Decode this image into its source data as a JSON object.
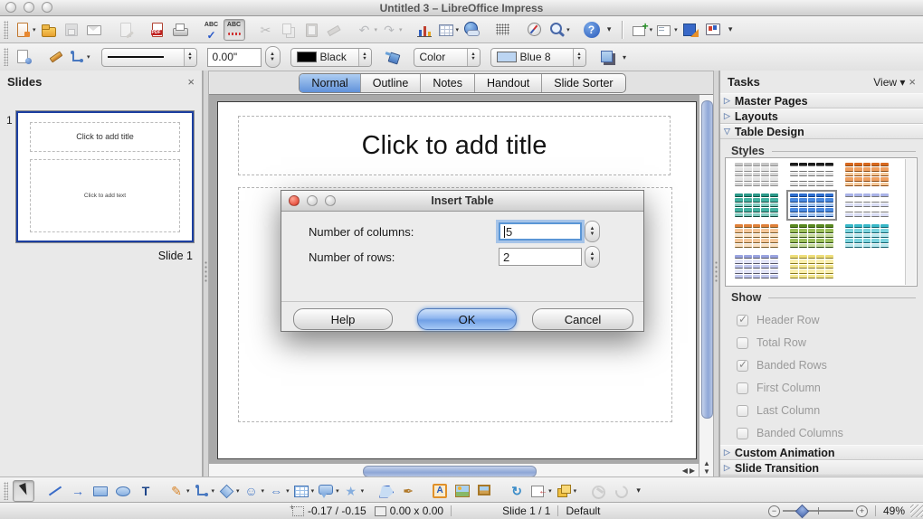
{
  "window": {
    "title": "Untitled 3 – LibreOffice Impress"
  },
  "toolbar_main": {
    "items": [
      {
        "name": "new-presentation",
        "kind": "doc",
        "dd": true
      },
      {
        "name": "open",
        "kind": "folder"
      },
      {
        "name": "save",
        "kind": "floppy",
        "disabled": true
      },
      {
        "name": "email",
        "kind": "mail"
      },
      {
        "gap": true
      },
      {
        "name": "edit-file",
        "kind": "editdoc",
        "disabled": true
      },
      {
        "gap": true
      },
      {
        "name": "export-pdf",
        "kind": "pdf"
      },
      {
        "name": "print",
        "kind": "print"
      },
      {
        "gap": true
      },
      {
        "name": "spelling",
        "kind": "abc-check"
      },
      {
        "name": "auto-spellcheck",
        "kind": "abc-wave",
        "active": true
      },
      {
        "gap": true
      },
      {
        "name": "cut",
        "kind": "char",
        "char": "✂",
        "color": "#666",
        "disabled": true
      },
      {
        "name": "copy",
        "kind": "copy",
        "disabled": true
      },
      {
        "name": "paste",
        "kind": "paste",
        "disabled": true
      },
      {
        "name": "clone-formatting",
        "kind": "brush",
        "disabled": true
      },
      {
        "gap": true
      },
      {
        "name": "undo",
        "kind": "char",
        "char": "↶",
        "color": "#3a62b8",
        "disabled": true,
        "dd": true
      },
      {
        "name": "redo",
        "kind": "char",
        "char": "↷",
        "color": "#3a62b8",
        "disabled": true,
        "dd": true
      },
      {
        "gap": true
      },
      {
        "name": "insert-chart",
        "kind": "chart"
      },
      {
        "name": "insert-table",
        "kind": "table",
        "dd": true
      },
      {
        "name": "hyperlink",
        "kind": "globe"
      },
      {
        "gap": true
      },
      {
        "name": "display-grid",
        "kind": "dots"
      },
      {
        "gap": true
      },
      {
        "name": "navigator",
        "kind": "compass"
      },
      {
        "name": "zoom",
        "kind": "zoomglass",
        "dd": true
      },
      {
        "gap": true
      },
      {
        "name": "help",
        "kind": "help"
      },
      {
        "name": "toolbar-overflow",
        "kind": "char",
        "char": "▾",
        "color": "#333",
        "small": true
      },
      {
        "sep": true
      },
      {
        "name": "new-slide",
        "kind": "slideplus",
        "dd": true
      },
      {
        "name": "slide-layout",
        "kind": "layout",
        "dd": true
      },
      {
        "name": "design",
        "kind": "design"
      },
      {
        "name": "start-presentation",
        "kind": "screen"
      },
      {
        "name": "presentation-overflow",
        "kind": "char",
        "char": "▾",
        "color": "#333",
        "small": true
      }
    ]
  },
  "toolbar_line": {
    "width_value": "0.00\"",
    "line_color_label": "Black",
    "line_color_hex": "#000000",
    "fill_type_label": "Color",
    "fill_color_label": "Blue 8",
    "fill_color_hex": "#bcd5f2",
    "icons": [
      "styles-preview-icon",
      "pen-icon",
      "arrow-style-icon",
      "line-style-combo",
      "fill-can-icon",
      "shadow-icon",
      "overflow-icon"
    ]
  },
  "view_tabs": {
    "items": [
      "Normal",
      "Outline",
      "Notes",
      "Handout",
      "Slide Sorter"
    ],
    "selected": 0
  },
  "slides_panel": {
    "title": "Slides",
    "close_glyph": "×",
    "slide_number": "1",
    "thumb_title": "Click to add title",
    "thumb_text": "Click to add text",
    "slide_label": "Slide 1"
  },
  "slide": {
    "title_placeholder": "Click to add title"
  },
  "dialog": {
    "title": "Insert Table",
    "fields": [
      {
        "label": "Number of columns:",
        "value": "5"
      },
      {
        "label": "Number of rows:",
        "value": "2"
      }
    ],
    "buttons": {
      "help": "Help",
      "ok": "OK",
      "cancel": "Cancel"
    }
  },
  "tasks": {
    "title": "Tasks",
    "view_label": "View",
    "view_arrow": "▾",
    "close_glyph": "×",
    "sections": [
      {
        "label": "Master Pages",
        "expanded": false
      },
      {
        "label": "Layouts",
        "expanded": false
      },
      {
        "label": "Table Design",
        "expanded": true
      }
    ],
    "styles_label": "Styles",
    "styles": [
      {
        "name": "grey",
        "h": "#c6c6c6",
        "a": "#e6e6e6",
        "b": "#d4d4d4",
        "ln": "#8a8a8a",
        "selected": false
      },
      {
        "name": "black-white",
        "h": "#1c1c1c",
        "a": "#ffffff",
        "b": "#e0e0e0",
        "ln": "#707070",
        "selected": false
      },
      {
        "name": "orange",
        "h": "#d8681f",
        "a": "#ef9f60",
        "b": "#f7c99b",
        "ln": "#8a4a14",
        "selected": false
      },
      {
        "name": "teal",
        "h": "#2b9a8a",
        "a": "#45b2a2",
        "b": "#82ccc0",
        "ln": "#114a3f",
        "selected": false
      },
      {
        "name": "blue",
        "h": "#2e6fd0",
        "a": "#4a8ae0",
        "b": "#9ec2f0",
        "ln": "#123a78",
        "selected": true
      },
      {
        "name": "periwinkle",
        "h": "#aab3e8",
        "a": "#ffffff",
        "b": "#d9ddf5",
        "ln": "#777777",
        "selected": false
      },
      {
        "name": "peach",
        "h": "#e0813a",
        "a": "#f5c89c",
        "b": "#fbe2c4",
        "ln": "#7a5a28",
        "selected": false
      },
      {
        "name": "green",
        "h": "#5a8a20",
        "a": "#9cc05c",
        "b": "#c6da9a",
        "ln": "#2e4a10",
        "selected": false
      },
      {
        "name": "cyan",
        "h": "#38b8c8",
        "a": "#7cd4de",
        "b": "#b8e8ee",
        "ln": "#11606c",
        "selected": false
      },
      {
        "name": "lavender",
        "h": "#9aa4e0",
        "a": "#e4e6f8",
        "b": "#c4caf0",
        "ln": "#555566",
        "selected": false
      },
      {
        "name": "yellow",
        "h": "#eede7a",
        "a": "#faf0b0",
        "b": "#f4e892",
        "ln": "#8a7a20",
        "selected": false
      }
    ],
    "show_label": "Show",
    "checkboxes": [
      {
        "label": "Header Row",
        "checked": true
      },
      {
        "label": "Total Row",
        "checked": false
      },
      {
        "label": "Banded Rows",
        "checked": true
      },
      {
        "label": "First Column",
        "checked": false
      },
      {
        "label": "Last Column",
        "checked": false
      },
      {
        "label": "Banded Columns",
        "checked": false
      }
    ],
    "bottom_sections": [
      "Custom Animation",
      "Slide Transition"
    ]
  },
  "toolbar_draw": {
    "items": [
      {
        "name": "select-tool",
        "kind": "cursor",
        "active": true
      },
      {
        "gap": true
      },
      {
        "name": "line-tool",
        "kind": "linetool"
      },
      {
        "name": "arrow-tool",
        "kind": "char",
        "char": "→",
        "color": "#3a6cc8",
        "bold": true
      },
      {
        "name": "rectangle-tool",
        "kind": "rect"
      },
      {
        "name": "ellipse-tool",
        "kind": "ellipse"
      },
      {
        "name": "text-tool",
        "kind": "char",
        "char": "T",
        "color": "#1c4488",
        "bold": true
      },
      {
        "gap": true
      },
      {
        "name": "curve-tool",
        "kind": "char",
        "char": "✎",
        "color": "#d88428",
        "dd": true
      },
      {
        "name": "connector-tool",
        "kind": "connector",
        "dd": true
      },
      {
        "name": "basic-shapes",
        "kind": "diamond",
        "dd": true
      },
      {
        "name": "symbol-shapes",
        "kind": "char",
        "char": "☺",
        "color": "#4a7cc8",
        "dd": true
      },
      {
        "name": "block-arrows",
        "kind": "char",
        "char": "⇔",
        "color": "#4a7cc8",
        "bold": true,
        "dd": true
      },
      {
        "name": "flowchart",
        "kind": "flowchart",
        "dd": true
      },
      {
        "name": "callouts",
        "kind": "callout",
        "dd": true
      },
      {
        "name": "stars",
        "kind": "char",
        "char": "★",
        "color": "#86aede",
        "dd": true
      },
      {
        "gap": true
      },
      {
        "name": "edit-points",
        "kind": "points"
      },
      {
        "name": "glue-points",
        "kind": "char",
        "char": "✒",
        "color": "#b07828"
      },
      {
        "gap": true
      },
      {
        "name": "fontwork",
        "kind": "fontwork"
      },
      {
        "name": "insert-image",
        "kind": "image"
      },
      {
        "name": "gallery",
        "kind": "gallery"
      },
      {
        "gap": true
      },
      {
        "name": "rotate",
        "kind": "char",
        "char": "↻",
        "color": "#3a8cc8",
        "bold": true
      },
      {
        "name": "alignment",
        "kind": "align",
        "dd": true
      },
      {
        "name": "arrange",
        "kind": "arrange",
        "dd": true
      },
      {
        "gap": true
      },
      {
        "name": "interaction",
        "kind": "interaction",
        "disabled": true
      },
      {
        "name": "effects",
        "kind": "effects",
        "disabled": true
      },
      {
        "name": "drawbar-overflow",
        "kind": "char",
        "char": "▾",
        "color": "#333",
        "small": true
      }
    ]
  },
  "statusbar": {
    "position": "-0.17 / -0.15",
    "size": "0.00 x 0.00",
    "slide": "Slide 1 / 1",
    "style_name": "Default",
    "zoom": "49%",
    "zoom_minus": "−",
    "zoom_plus": "+"
  }
}
